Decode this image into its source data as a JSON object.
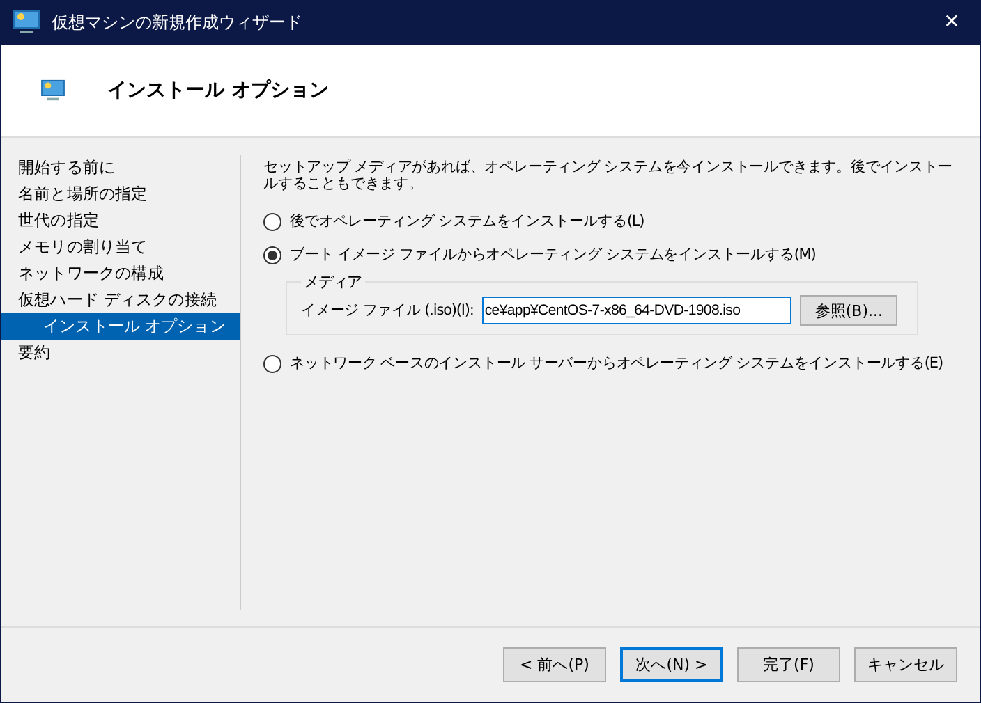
{
  "window": {
    "title": "仮想マシンの新規作成ウィザード",
    "close": "✕"
  },
  "header": {
    "title": "インストール オプション"
  },
  "sidebar": {
    "items": [
      {
        "label": "開始する前に",
        "selected": false
      },
      {
        "label": "名前と場所の指定",
        "selected": false
      },
      {
        "label": "世代の指定",
        "selected": false
      },
      {
        "label": "メモリの割り当て",
        "selected": false
      },
      {
        "label": "ネットワークの構成",
        "selected": false
      },
      {
        "label": "仮想ハード ディスクの接続",
        "selected": false,
        "children": [
          {
            "label": "インストール オプション",
            "selected": true
          }
        ]
      },
      {
        "label": "要約",
        "selected": false
      }
    ]
  },
  "content": {
    "description": "セットアップ メディアがあれば、オペレーティング システムを今インストールできます。後でインストールすることもできます。",
    "options": [
      {
        "label": "後でオペレーティング システムをインストールする(L)",
        "selected": false
      },
      {
        "label": "ブート イメージ ファイルからオペレーティング システムをインストールする(M)",
        "selected": true,
        "media": {
          "legend": "メディア",
          "label": "イメージ ファイル (.iso)(I):",
          "value": "ce¥app¥CentOS-7-x86_64-DVD-1908.iso",
          "browse": "参照(B)..."
        }
      },
      {
        "label": "ネットワーク ベースのインストール サーバーからオペレーティング システムをインストールする(E)",
        "selected": false
      }
    ]
  },
  "buttons": [
    {
      "label": "< 前へ(P)",
      "focused": false
    },
    {
      "label": "次へ(N) >",
      "focused": true
    },
    {
      "label": "完了(F)",
      "focused": false
    },
    {
      "label": "キャンセル",
      "focused": false
    }
  ]
}
